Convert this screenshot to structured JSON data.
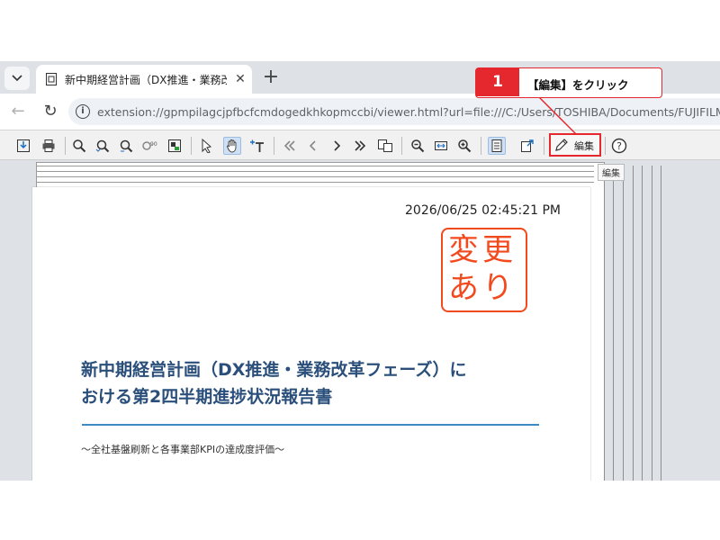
{
  "browser": {
    "tab_title": "新中期経営計画（DX推進・業務改革フ",
    "tab_close": "✕",
    "new_tab": "+",
    "url": "extension://gpmpilagcjpfbcfcmdogedkhkopmccbi/viewer.html?url=file:///C:/Users/TOSHIBA/Documents/FUJIFILM"
  },
  "viewer": {
    "edit_label": "編集",
    "edit_tooltip": "編集"
  },
  "document": {
    "timestamp": "2026/06/25 02:45:21 PM",
    "stamp_text": "変更あり",
    "title_line1": "新中期経営計画（DX推進・業務改革フェーズ）に",
    "title_line2": "おける第2四半期進捗状況報告書",
    "subtitle": "～全社基盤刷新と各事業部KPIの達成度評価～"
  },
  "callout": {
    "step": "1",
    "text": "【編集】をクリック"
  },
  "colors": {
    "accent_red": "#e5282e",
    "stamp_orange": "#f24a1f",
    "title_blue": "#2b4f7b",
    "rule_blue": "#3a8ac8"
  }
}
